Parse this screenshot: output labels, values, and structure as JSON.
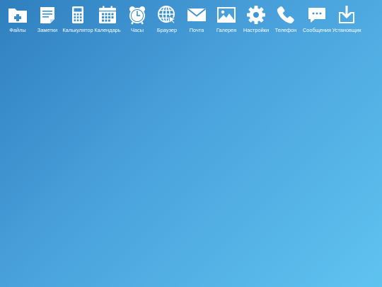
{
  "desktop": {
    "background": {
      "start": "#2f7fbf",
      "end": "#5fc3f0"
    },
    "apps": [
      {
        "label": "Файлы",
        "icon": "folder-plus-icon"
      },
      {
        "label": "Заметки",
        "icon": "notes-icon"
      },
      {
        "label": "Калькулятор",
        "icon": "calculator-icon"
      },
      {
        "label": "Календарь",
        "icon": "calendar-icon"
      },
      {
        "label": "Часы",
        "icon": "alarm-clock-icon"
      },
      {
        "label": "Браузер",
        "icon": "globe-cursor-icon"
      },
      {
        "label": "Почта",
        "icon": "envelope-icon"
      },
      {
        "label": "Галерея",
        "icon": "image-icon"
      },
      {
        "label": "Настройки",
        "icon": "gear-icon"
      },
      {
        "label": "Телефон",
        "icon": "phone-icon"
      },
      {
        "label": "Сообщения",
        "icon": "chat-bubble-icon"
      },
      {
        "label": "Установщик",
        "icon": "download-box-icon"
      }
    ]
  }
}
